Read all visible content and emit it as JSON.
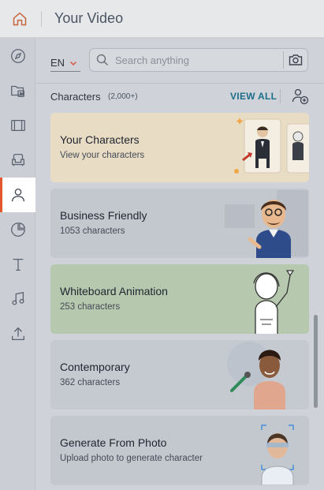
{
  "header": {
    "title": "Your Video",
    "home_icon": "home-icon"
  },
  "sidebar": {
    "items": [
      {
        "name": "explore",
        "icon": "compass-icon"
      },
      {
        "name": "media",
        "icon": "media-folder-icon"
      },
      {
        "name": "scenes",
        "icon": "film-icon"
      },
      {
        "name": "props",
        "icon": "chair-icon"
      },
      {
        "name": "characters",
        "icon": "person-icon",
        "active": true
      },
      {
        "name": "charts",
        "icon": "pie-chart-icon"
      },
      {
        "name": "text",
        "icon": "text-icon"
      },
      {
        "name": "music",
        "icon": "music-note-icon"
      },
      {
        "name": "upload",
        "icon": "upload-icon"
      }
    ],
    "active_color": "#e2572b"
  },
  "toolbar": {
    "language": "EN",
    "search_placeholder": "Search anything",
    "search_value": ""
  },
  "section": {
    "title": "Characters",
    "count": "(2,000+)",
    "view_all": "VIEW ALL",
    "accent": "#1b6f8a"
  },
  "cards": [
    {
      "title": "Your Characters",
      "subtitle": "View your characters",
      "bg": "#e8dcc4"
    },
    {
      "title": "Business Friendly",
      "subtitle": "1053 characters",
      "bg": "#c3c8cf"
    },
    {
      "title": "Whiteboard Animation",
      "subtitle": "253 characters",
      "bg": "#b6c9ae"
    },
    {
      "title": "Contemporary",
      "subtitle": "362 characters",
      "bg": "#c5c9d0"
    },
    {
      "title": "Generate From Photo",
      "subtitle": "Upload photo to generate character",
      "bg": "#c3c8cf"
    }
  ],
  "scroll": {
    "position_fraction": 0.57
  }
}
